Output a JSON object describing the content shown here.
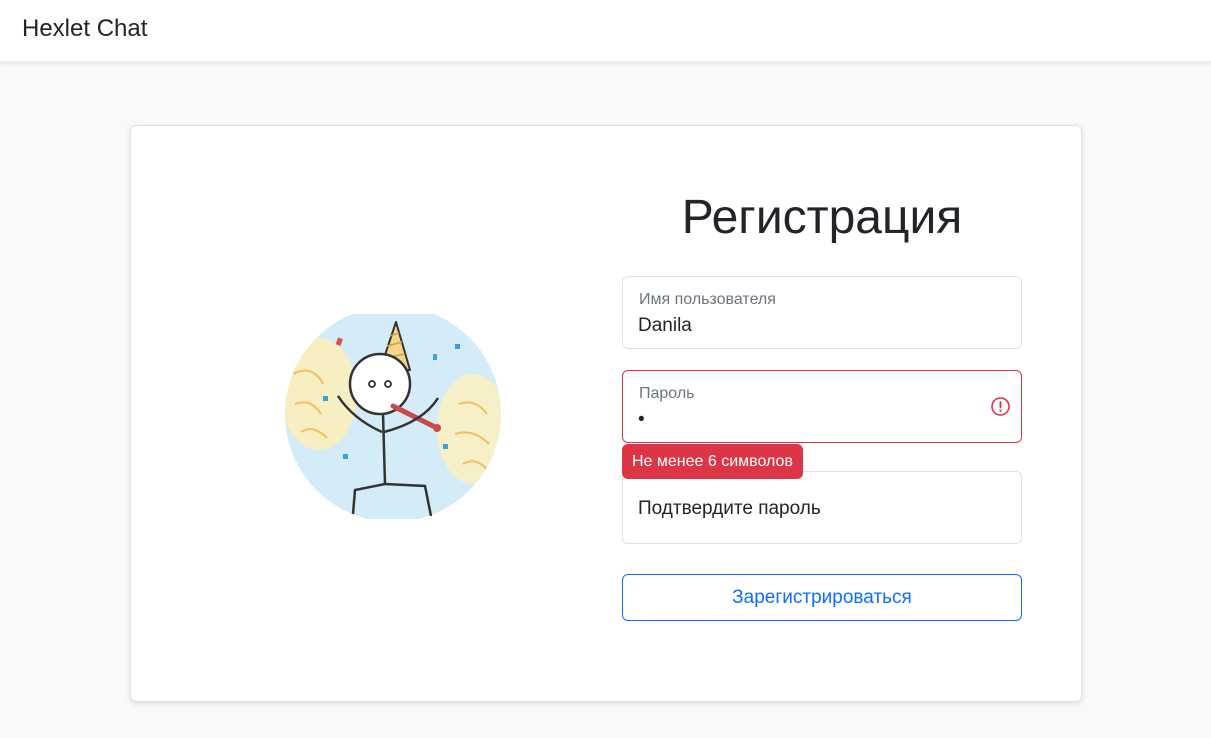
{
  "navbar": {
    "brand": "Hexlet Chat"
  },
  "form": {
    "title": "Регистрация",
    "username": {
      "label": "Имя пользователя",
      "value": "Danila"
    },
    "password": {
      "label": "Пароль",
      "value": "•",
      "error": "Не менее 6 символов"
    },
    "confirm": {
      "placeholder": "Подтвердите пароль"
    },
    "submit_label": "Зарегистрироваться"
  },
  "colors": {
    "primary": "#0d6efd",
    "danger": "#dc3545",
    "background": "#f8f9fa"
  },
  "icons": {
    "password_error": "exclamation-circle-icon"
  }
}
